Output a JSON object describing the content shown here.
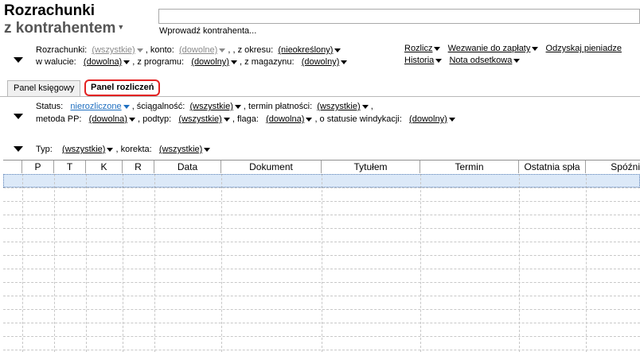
{
  "title": {
    "line1": "Rozrachunki",
    "line2": "z kontrahentem"
  },
  "contractor": {
    "value": "",
    "hint": "Wprowadź kontrahenta..."
  },
  "filters1": {
    "rozrachunki_label": "Rozrachunki:",
    "rozrachunki_value": "(wszystkie)",
    "konto_label": ", konto:",
    "konto_value": "(dowolne)",
    "okres_label": ", z okresu:",
    "okres_value": "(nieokreślony)",
    "waluta_label": "w walucie:",
    "waluta_value": "(dowolna)",
    "program_label": ", z programu:",
    "program_value": "(dowolny)",
    "magazyn_label": ", z magazynu:",
    "magazyn_value": "(dowolny)"
  },
  "actions": {
    "rozlicz": "Rozlicz",
    "wezwanie": "Wezwanie do zapłaty",
    "odzyskaj": "Odzyskaj pieniadze",
    "historia": "Historia",
    "nota": "Nota odsetkowa"
  },
  "tabs": [
    {
      "label": "Panel księgowy"
    },
    {
      "label": "Panel rozliczeń"
    }
  ],
  "filters2": {
    "status_label": "Status:",
    "status_value": "nierozliczone",
    "sciagalnosc_label": ", ściągalność:",
    "sciagalnosc_value": "(wszystkie)",
    "termin_label": ", termin płatności:",
    "termin_value": "(wszystkie)",
    "comma": ",",
    "metoda_label": "metoda PP:",
    "metoda_value": "(dowolna)",
    "podtyp_label": ", podtyp:",
    "podtyp_value": "(wszystkie)",
    "flaga_label": ", flaga:",
    "flaga_value": "(dowolna)",
    "windykacja_label": ", o statusie windykacji:",
    "windykacja_value": "(dowolny)"
  },
  "filters3": {
    "typ_label": "Typ:",
    "typ_value": "(wszystkie)",
    "korekta_label": ", korekta:",
    "korekta_value": "(wszystkie)"
  },
  "table": {
    "columns": [
      "",
      "P",
      "T",
      "K",
      "R",
      "Data",
      "Dokument",
      "Tytułem",
      "Termin",
      "Ostatnia spła",
      "Spóźni"
    ]
  }
}
